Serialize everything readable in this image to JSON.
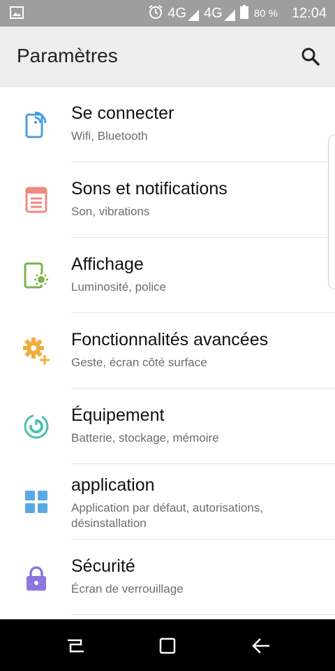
{
  "status_bar": {
    "network1": "4G",
    "network2": "4G",
    "battery": "80 %",
    "time": "12:04"
  },
  "app_bar": {
    "title": "Paramètres"
  },
  "settings": [
    {
      "title": "Se connecter",
      "subtitle": "Wifi, Bluetooth",
      "color": "#4a9fe0"
    },
    {
      "title": "Sons et notifications",
      "subtitle": "Son, vibrations",
      "color": "#ef8a80"
    },
    {
      "title": "Affichage",
      "subtitle": "Luminosité, police",
      "color": "#7bb24a"
    },
    {
      "title": "Fonctionnalités avancées",
      "subtitle": "Geste, écran côté surface",
      "color": "#f0ae3c"
    },
    {
      "title": "Équipement",
      "subtitle": "Batterie, stockage, mémoire",
      "color": "#4fc0ae"
    },
    {
      "title": "application",
      "subtitle": "Application par défaut, autorisations, désinstallation",
      "color": "#5aa9e4"
    },
    {
      "title": "Sécurité",
      "subtitle": "Écran de verrouillage",
      "color": "#8e75e0"
    }
  ]
}
